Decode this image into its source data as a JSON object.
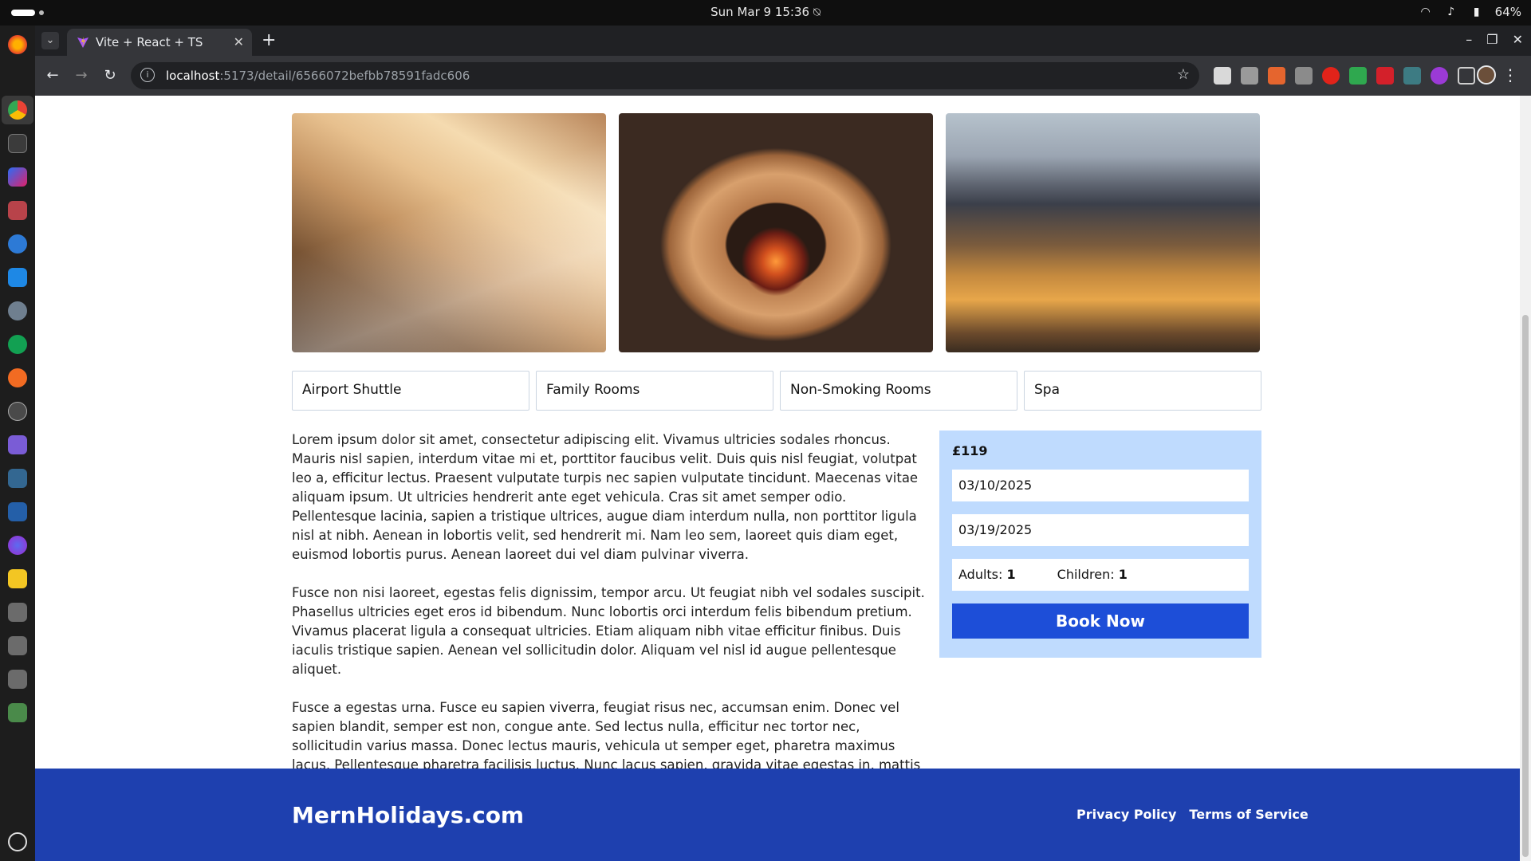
{
  "system": {
    "clock": "Sun Mar 9  15:36",
    "battery": "64%"
  },
  "browser": {
    "tab_title": "Vite + React + TS",
    "url_host": "localhost",
    "url_path": ":5173/detail/6566072befbb78591fadc606"
  },
  "hotel": {
    "images": [
      {
        "name": "cabin-interior-photo"
      },
      {
        "name": "barrel-sauna-photo"
      },
      {
        "name": "city-evening-photo"
      }
    ],
    "facilities": [
      "Airport Shuttle",
      "Family Rooms",
      "Non-Smoking Rooms",
      "Spa"
    ],
    "description": [
      "Lorem ipsum dolor sit amet, consectetur adipiscing elit. Vivamus ultricies sodales rhoncus. Mauris nisl sapien, interdum vitae mi et, porttitor faucibus velit. Duis quis nisl feugiat, volutpat leo a, efficitur lectus. Praesent vulputate turpis nec sapien vulputate tincidunt. Maecenas vitae aliquam ipsum. Ut ultricies hendrerit ante eget vehicula. Cras sit amet semper odio. Pellentesque lacinia, sapien a tristique ultrices, augue diam interdum nulla, non porttitor ligula nisl at nibh. Aenean in lobortis velit, sed hendrerit mi. Nam leo sem, laoreet quis diam eget, euismod lobortis purus. Aenean laoreet dui vel diam pulvinar viverra.",
      "Fusce non nisi laoreet, egestas felis dignissim, tempor arcu. Ut feugiat nibh vel sodales suscipit. Phasellus ultricies eget eros id bibendum. Nunc lobortis orci interdum felis bibendum pretium. Vivamus placerat ligula a consequat ultricies. Etiam aliquam nibh vitae efficitur finibus. Duis iaculis tristique sapien. Aenean vel sollicitudin dolor. Aliquam vel nisl id augue pellentesque aliquet.",
      "Fusce a egestas urna. Fusce eu sapien viverra, feugiat risus nec, accumsan enim. Donec vel sapien blandit, semper est non, congue ante. Sed lectus nulla, efficitur nec tortor nec, sollicitudin varius massa. Donec lectus mauris, vehicula ut semper eget, pharetra maximus lacus. Pellentesque pharetra facilisis luctus. Nunc lacus sapien, gravida vitae egestas in, mattis in tellus."
    ]
  },
  "booking": {
    "price": "£119",
    "check_in": "03/10/2025",
    "check_out": "03/19/2025",
    "adults_label": "Adults:",
    "adults_value": "1",
    "children_label": "Children:",
    "children_value": "1",
    "book_label": "Book Now"
  },
  "footer": {
    "brand": "MernHolidays.com",
    "links": [
      "Privacy Policy",
      "Terms of Service"
    ]
  }
}
